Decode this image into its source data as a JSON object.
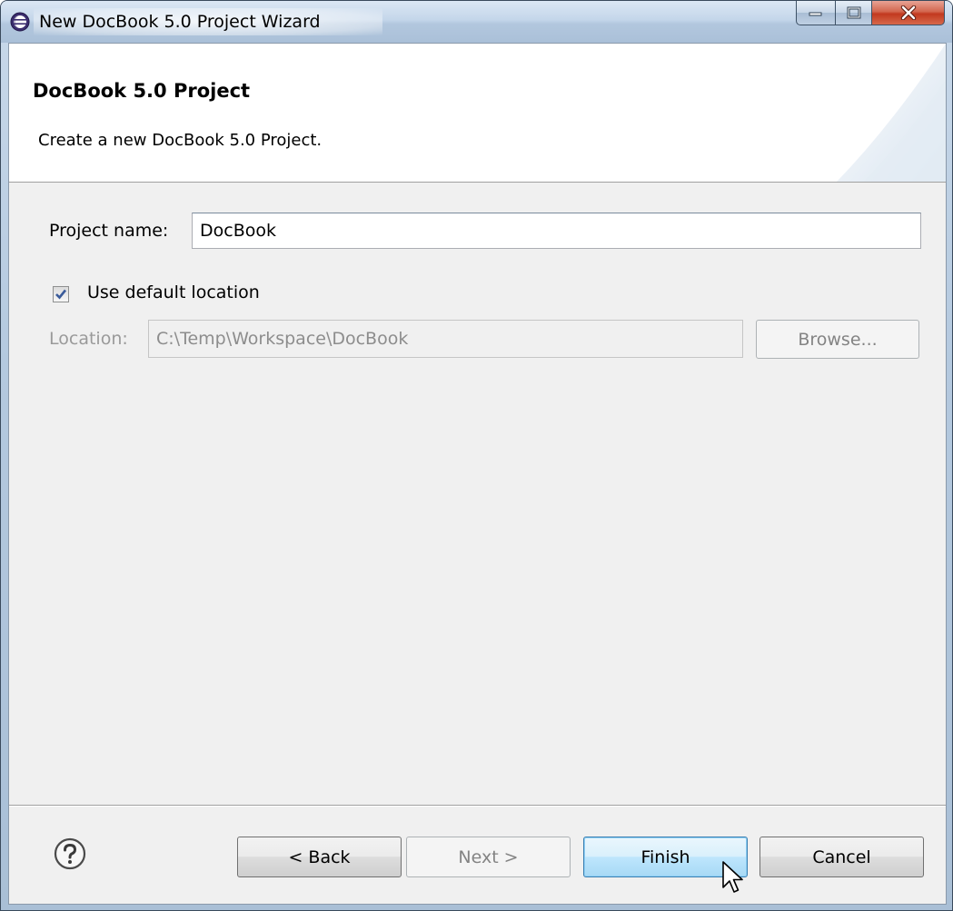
{
  "window": {
    "title": "New DocBook 5.0 Project Wizard"
  },
  "banner": {
    "title": "DocBook 5.0 Project",
    "description": "Create a new DocBook 5.0 Project."
  },
  "form": {
    "project_name_label": "Project name:",
    "project_name_value": "DocBook",
    "use_default_location_label": "Use default location",
    "use_default_location_checked": true,
    "location_label": "Location:",
    "location_value": "C:\\Temp\\Workspace\\DocBook",
    "browse_label": "Browse..."
  },
  "footer": {
    "back_label": "< Back",
    "next_label": "Next >",
    "finish_label": "Finish",
    "cancel_label": "Cancel"
  },
  "icons": {
    "window_icon": "eclipse-icon",
    "help_icon": "help-icon",
    "cursor": "mouse-pointer-icon"
  },
  "colors": {
    "default_button_border": "#3c7fb1",
    "close_button": "#c2391f",
    "checkbox_mark": "#3a5b9a"
  }
}
